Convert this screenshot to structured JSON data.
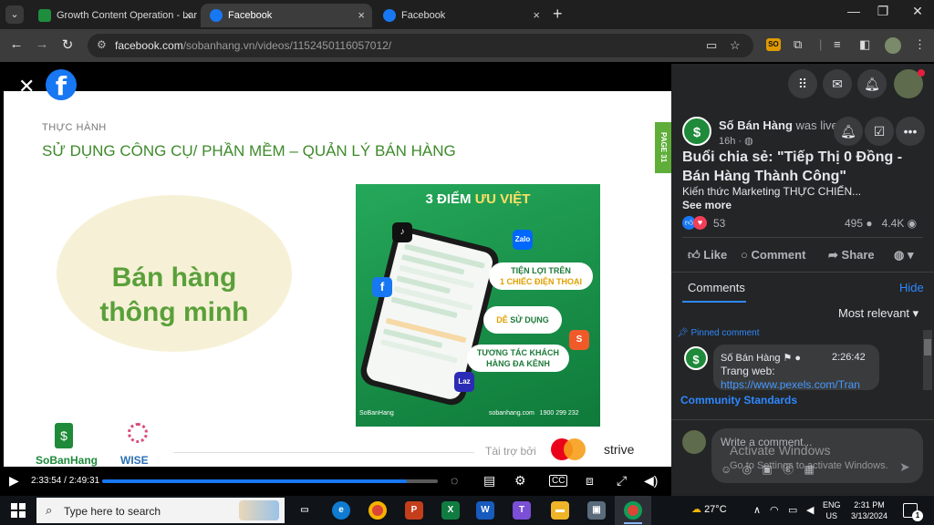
{
  "browser": {
    "tabs": [
      {
        "title": "Growth Content Operation - Lar",
        "active": false,
        "favicon_color": "#1e8e3e"
      },
      {
        "title": "Facebook",
        "active": true,
        "favicon_color": "#1877f2"
      },
      {
        "title": "Facebook",
        "active": false,
        "favicon_color": "#1877f2"
      }
    ],
    "url_host": "facebook.com",
    "url_path": "/sobanhang.vn/videos/1152450116057012/",
    "extension_badge": "SO"
  },
  "slide": {
    "kicker": "THỰC HÀNH",
    "title": "SỬ DỤNG CÔNG CỤ/ PHẦN MỀM – QUẢN LÝ BÁN HÀNG",
    "page_tab": "PAGE 31",
    "circle_line1": "Bán hàng",
    "circle_line2": "thông minh",
    "promo_title_prefix": "3 ĐIỂM ",
    "promo_title_accent": "ƯU VIỆT",
    "pill1_line1": "TIỆN LỢI TRÊN",
    "pill1_line2": "1 CHIẾC ĐIỆN THOẠI",
    "pill2_accent": "DỄ",
    "pill2_rest": " SỬ DỤNG",
    "pill3_line1": "TƯƠNG TÁC KHÁCH",
    "pill3_line2": "HÀNG ĐA KÊNH",
    "app_zalo": "Zalo",
    "app_laz": "Laz",
    "promo_brand": "SoBanHang",
    "promo_site": "sobanhang.com",
    "promo_phone": "1900 299 232",
    "logo1": "SoBanHang",
    "logo2": "WISE",
    "sponsor_label": "Tài trợ bởi",
    "sponsor_strive": "strive"
  },
  "player": {
    "current_time": "2:33:54",
    "duration": "2:49:31",
    "progress_fraction": 0.908
  },
  "panel": {
    "page_name": "Số Bán Hàng",
    "live_text": "was live.",
    "age": "16h",
    "post_title": "Buổi chia sẻ: \"Tiếp Thị 0 Đồng - Bán Hàng Thành Công\"",
    "post_desc": "Kiến thức Marketing THỰC CHIẾN...",
    "see_more": "See more",
    "reaction_count": "53",
    "comment_count": "495",
    "view_count": "4.4K",
    "actions": {
      "like": "Like",
      "comment": "Comment",
      "share": "Share"
    },
    "comments_tab": "Comments",
    "hide": "Hide",
    "sort": "Most relevant",
    "pinned_label": "Pinned comment",
    "comment_author": "Số Bán Hàng",
    "comment_time": "2:26:42",
    "comment_line1": "Trang web:",
    "comment_link": "https://www.pexels.com/Tran",
    "community_standards": "Community Standards",
    "write_placeholder": "Write a comment...",
    "watermark_title": "Activate Windows",
    "watermark_sub": "Go to Settings to activate Windows."
  },
  "taskbar": {
    "search_placeholder": "Type here to search",
    "temperature": "27°C",
    "lang1": "ENG",
    "lang2": "US",
    "time": "2:31 PM",
    "date": "3/13/2024",
    "notification_count": "1"
  }
}
